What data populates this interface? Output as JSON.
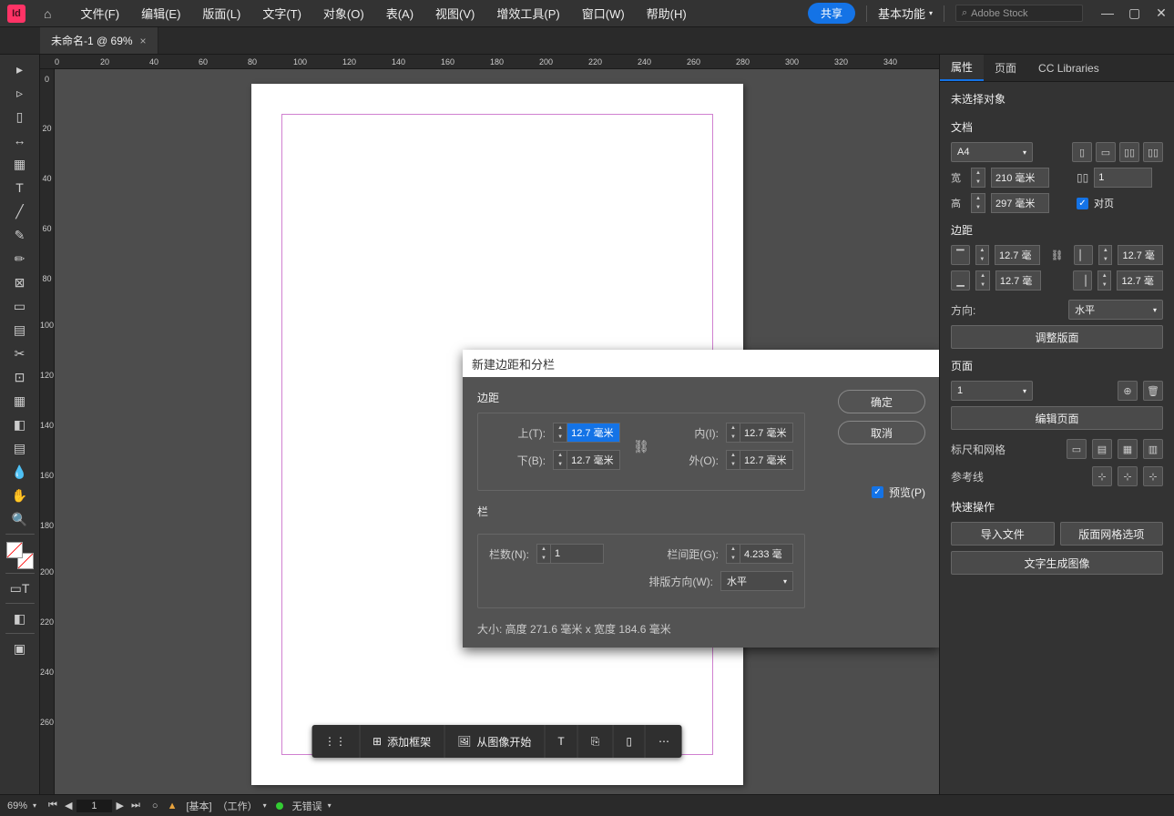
{
  "menubar": {
    "menus": [
      "文件(F)",
      "编辑(E)",
      "版面(L)",
      "文字(T)",
      "对象(O)",
      "表(A)",
      "视图(V)",
      "增效工具(P)",
      "窗口(W)",
      "帮助(H)"
    ],
    "share": "共享",
    "workspace": "基本功能",
    "search_placeholder": "Adobe Stock"
  },
  "doc_tab": {
    "title": "未命名-1 @ 69%"
  },
  "dialog": {
    "title": "新建边距和分栏",
    "margins_label": "边距",
    "top_label": "上(T):",
    "bottom_label": "下(B):",
    "inside_label": "内(I):",
    "outside_label": "外(O):",
    "top_value": "12.7 毫米",
    "bottom_value": "12.7 毫米",
    "inside_value": "12.7 毫米",
    "outside_value": "12.7 毫米",
    "columns_label": "栏",
    "count_label": "栏数(N):",
    "count_value": "1",
    "gutter_label": "栏间距(G):",
    "gutter_value": "4.233 毫",
    "direction_label": "排版方向(W):",
    "direction_value": "水平",
    "ok": "确定",
    "cancel": "取消",
    "preview": "预览(P)",
    "size_text": "大小: 高度 271.6 毫米 x 宽度 184.6 毫米"
  },
  "panel": {
    "tabs": [
      "属性",
      "页面",
      "CC Libraries"
    ],
    "status": "未选择对象",
    "doc_label": "文档",
    "preset": "A4",
    "width_label": "宽",
    "width_value": "210 毫米",
    "height_label": "高",
    "height_value": "297 毫米",
    "pages_value": "1",
    "facing": "对页",
    "margins_label": "边距",
    "m_top": "12.7 毫",
    "m_bottom": "12.7 毫",
    "m_left": "12.7 毫",
    "m_right": "12.7 毫",
    "dir_label": "方向:",
    "dir_value": "水平",
    "adjust_layout": "调整版面",
    "pages_label": "页面",
    "page_num": "1",
    "edit_pages": "编辑页面",
    "rulers_label": "标尺和网格",
    "guides_label": "参考线",
    "quick_label": "快速操作",
    "import": "导入文件",
    "grid_opts": "版面网格选项",
    "text_to_img": "文字生成图像"
  },
  "float_toolbar": {
    "add_frame": "添加框架",
    "from_image": "从图像开始"
  },
  "statusbar": {
    "zoom": "69%",
    "page": "1",
    "basic": "[基本]",
    "work": "（工作）",
    "no_error": "无错误"
  }
}
